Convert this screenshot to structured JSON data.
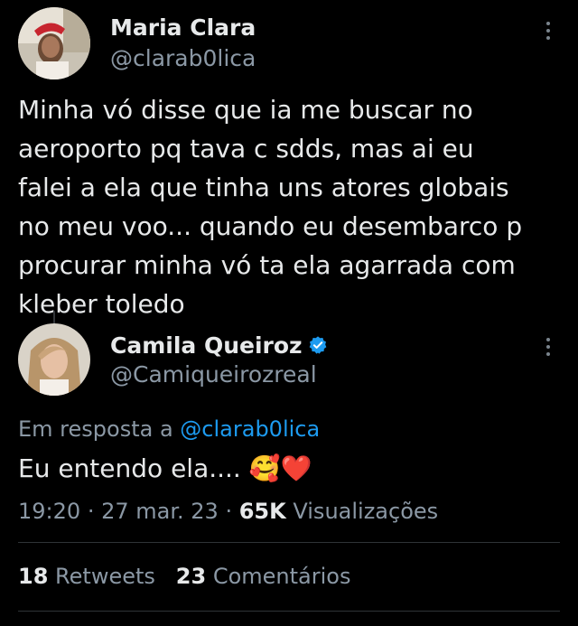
{
  "tweet": {
    "author_name": "Maria Clara",
    "author_handle": "@clarab0lica",
    "text": "Minha vó disse que ia me buscar no\naeroporto pq tava c sdds, mas ai eu\nfalei a ela que tinha uns atores globais\nno meu voo... quando eu desembarco p\nprocurar minha vó ta ela agarrada com\nkleber toledo"
  },
  "reply": {
    "author_name": "Camila Queiroz",
    "author_handle": "@Camiqueirozreal",
    "verified_color": "#1d9bf0",
    "reply_prefix": "Em resposta a",
    "reply_link": "@clarab0lica",
    "text": "Eu entendo ela....",
    "emoji": "🥰❤️",
    "time": "19:20",
    "date": "27 mar. 23",
    "views_count": "65K",
    "views_label": "Visualizações",
    "separator": "·",
    "retweets_count": "18",
    "retweets_label": "Retweets",
    "comments_count": "23",
    "comments_label": "Comentários"
  },
  "icons": {
    "more": "more-vertical-icon",
    "verified": "verified-badge-icon"
  },
  "colors": {
    "background": "#000000",
    "text": "#e7e9ea",
    "secondary": "#8b98a5",
    "link": "#1d9bf0"
  }
}
